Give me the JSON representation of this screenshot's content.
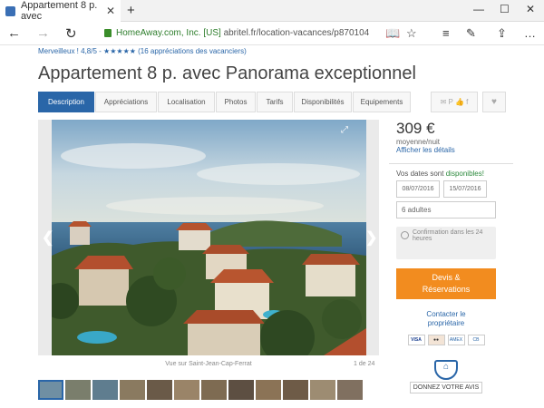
{
  "browser": {
    "tab_title": "Appartement 8 p. avec",
    "url_secure": "HomeAway.com, Inc. [US]",
    "url_path": "abritel.fr/location-vacances/p870104",
    "new_tab": "+",
    "minimize": "—",
    "maximize": "☐",
    "close": "✕"
  },
  "listing": {
    "rating_text": "Merveilleux ! 4,8/5 -",
    "stars": "★★★★★",
    "reviews": "(16 appréciations des vacanciers)",
    "title": "Appartement 8 p. avec Panorama exceptionnel",
    "tabs": [
      {
        "label": "Description"
      },
      {
        "label": "Appréciations"
      },
      {
        "label": "Localisation"
      },
      {
        "label": "Photos"
      },
      {
        "label": "Tarifs"
      },
      {
        "label": "Disponibilités"
      },
      {
        "label": "Equipements"
      }
    ]
  },
  "gallery": {
    "caption": "Vue sur Saint-Jean-Cap-Ferrat",
    "counter": "1 de 24"
  },
  "booking": {
    "price": "309 €",
    "per": "moyenne/nuit",
    "details_link": "Afficher les détails",
    "avail_prefix": "Vos dates sont",
    "avail_status": "disponibles!",
    "date_from": "08/07/2016",
    "date_to": "15/07/2016",
    "guests": "6 adultes",
    "confirm_text": "Confirmation dans les 24 heures",
    "cta_line1": "Devis &",
    "cta_line2": "Réservations",
    "contact_line1": "Contacter le",
    "contact_line2": "propriétaire",
    "review_btn": "DONNEZ VOTRE AVIS"
  },
  "colors": {
    "accent": "#2a66a8",
    "cta": "#f28c1f",
    "secure": "#2d7d2b"
  }
}
